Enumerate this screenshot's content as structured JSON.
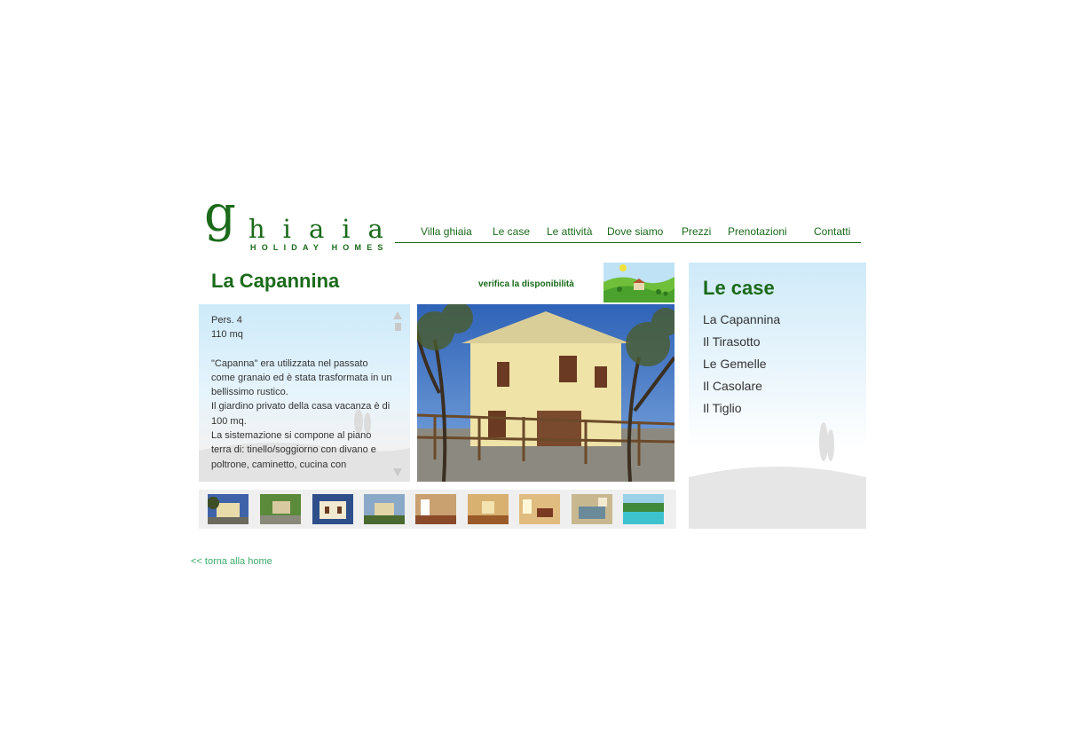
{
  "logo": {
    "initial": "g",
    "word": "hiaia",
    "subtitle": "HOLIDAY HOMES"
  },
  "nav": {
    "items": [
      "Villa ghiaia",
      "Le case",
      "Le attività",
      "Dove siamo",
      "Prezzi",
      "Prenotazioni",
      "Contatti"
    ]
  },
  "house": {
    "title": "La Capannina",
    "check_availability": "verifica la disponibilità",
    "persons": "Pers. 4",
    "area": "110 mq",
    "desc_1": "\"Capanna\" era utilizzata nel passato come granaio ed è stata trasformata in un bellissimo rustico.",
    "desc_2": "Il giardino privato della casa vacanza è di 100 mq.",
    "desc_3": "La sistemazione si compone al piano terra di: tinello/soggiorno con divano e poltrone, caminetto, cucina con"
  },
  "sidebar": {
    "title": "Le case",
    "items": [
      "La Capannina",
      "Il Tirasotto",
      "Le Gemelle",
      "Il Casolare",
      "Il Tiglio"
    ]
  },
  "back_link": "<< torna alla home",
  "colors": {
    "brand_green": "#1a6a1a",
    "link_green": "#3daa6a",
    "panel_blue": "#cdeaf9"
  },
  "icons": [
    "scroll-up-arrow-icon",
    "scroll-down-arrow-icon"
  ]
}
